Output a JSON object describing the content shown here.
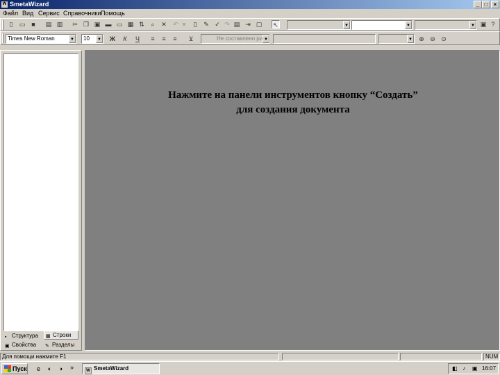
{
  "window": {
    "title": "SmetaWizard",
    "icon_label": "W",
    "minimize_label": "_",
    "maximize_label": "□",
    "close_label": "×"
  },
  "menu": {
    "items": [
      {
        "label": "Файл"
      },
      {
        "label": "Вид"
      },
      {
        "label": "Сервис"
      },
      {
        "label": "Справочники"
      },
      {
        "label": "Помощь"
      }
    ]
  },
  "format_toolbar": {
    "font_value": "Times New Roman",
    "size_value": "10",
    "bold_label": "Ж",
    "italic_label": "К",
    "underline_label": "Ч",
    "style_value": "Не составлено рис"
  },
  "icons": {
    "new": "new-icon",
    "open": "open-icon",
    "save": "save-icon",
    "print": "print-icon",
    "cut": "cut-icon",
    "copy": "copy-icon",
    "paste": "paste-icon",
    "undo": "undo-icon",
    "redo": "redo-icon",
    "zoom_in": "zoom-in-icon",
    "zoom_out": "zoom-out-icon"
  },
  "left_panel": {
    "tabs": [
      {
        "label": "Структура"
      },
      {
        "label": "Строки"
      },
      {
        "label": "Свойства"
      },
      {
        "label": "Разделы"
      }
    ]
  },
  "main": {
    "message_line1": "Нажмите на панели инструментов кнопку “Создать”",
    "message_line2": "для создания документа",
    "background_color": "#808080"
  },
  "status_bar": {
    "help_text": "Для помощи нажмите F1",
    "mode": "NUM"
  },
  "taskbar": {
    "start_label": "Пуск",
    "task_label": "SmetaWizard",
    "chevron": "»",
    "clock": "16:07"
  }
}
